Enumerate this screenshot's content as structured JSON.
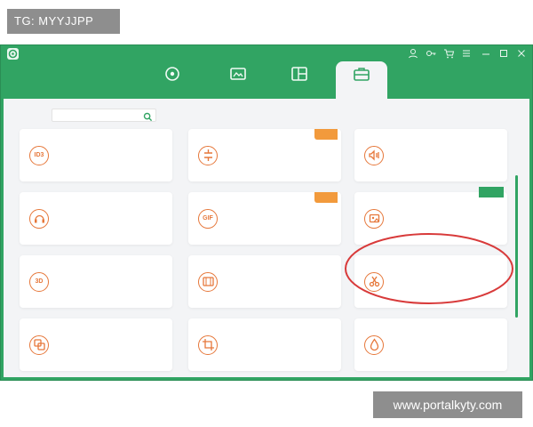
{
  "watermark": {
    "top_left": "TG: MYYJJPP",
    "bottom_right": "www.portalkyty.com"
  },
  "app": {
    "title": "",
    "logo_icon": "app-logo-icon"
  },
  "window_controls": [
    "user-icon",
    "key-icon",
    "cart-icon",
    "menu-icon",
    "minimize-icon",
    "maximize-icon",
    "close-icon"
  ],
  "tabs": [
    {
      "label": "",
      "icon": "convert-icon"
    },
    {
      "label": "",
      "icon": "short-video-icon"
    },
    {
      "label": "",
      "icon": "split-screen-icon"
    },
    {
      "label": "",
      "icon": "toolbox-icon",
      "active": true
    }
  ],
  "search": {
    "label": "",
    "value": "",
    "icon": "search-icon"
  },
  "cards": [
    {
      "name": "",
      "desc": "",
      "icon": "ID3"
    },
    {
      "name": "",
      "desc": "",
      "icon": "compress-icon",
      "badge": ""
    },
    {
      "name": "",
      "desc": "",
      "icon": "audio-compress-icon"
    },
    {
      "name": "",
      "desc": "",
      "icon": "noise-removal-icon"
    },
    {
      "name": "",
      "desc": "",
      "icon": "GIF",
      "badge": ""
    },
    {
      "name": "",
      "desc": "",
      "icon": "image-convert-icon",
      "badge": "",
      "circled": true
    },
    {
      "name": "",
      "desc": "",
      "icon": "3D"
    },
    {
      "name": "",
      "desc": "",
      "icon": "enhance-icon"
    },
    {
      "name": "",
      "desc": "",
      "icon": "split-icon"
    },
    {
      "name": "",
      "desc": "",
      "icon": "merge-icon"
    },
    {
      "name": "",
      "desc": "",
      "icon": "crop-icon"
    },
    {
      "name": "",
      "desc": "",
      "icon": "watermark-icon"
    }
  ],
  "colors": {
    "accent_green": "#31a463",
    "accent_orange": "#e6773a",
    "badge_orange": "#f29a3c",
    "annotation_red": "#d83a3a",
    "content_bg": "#f3f4f6"
  }
}
